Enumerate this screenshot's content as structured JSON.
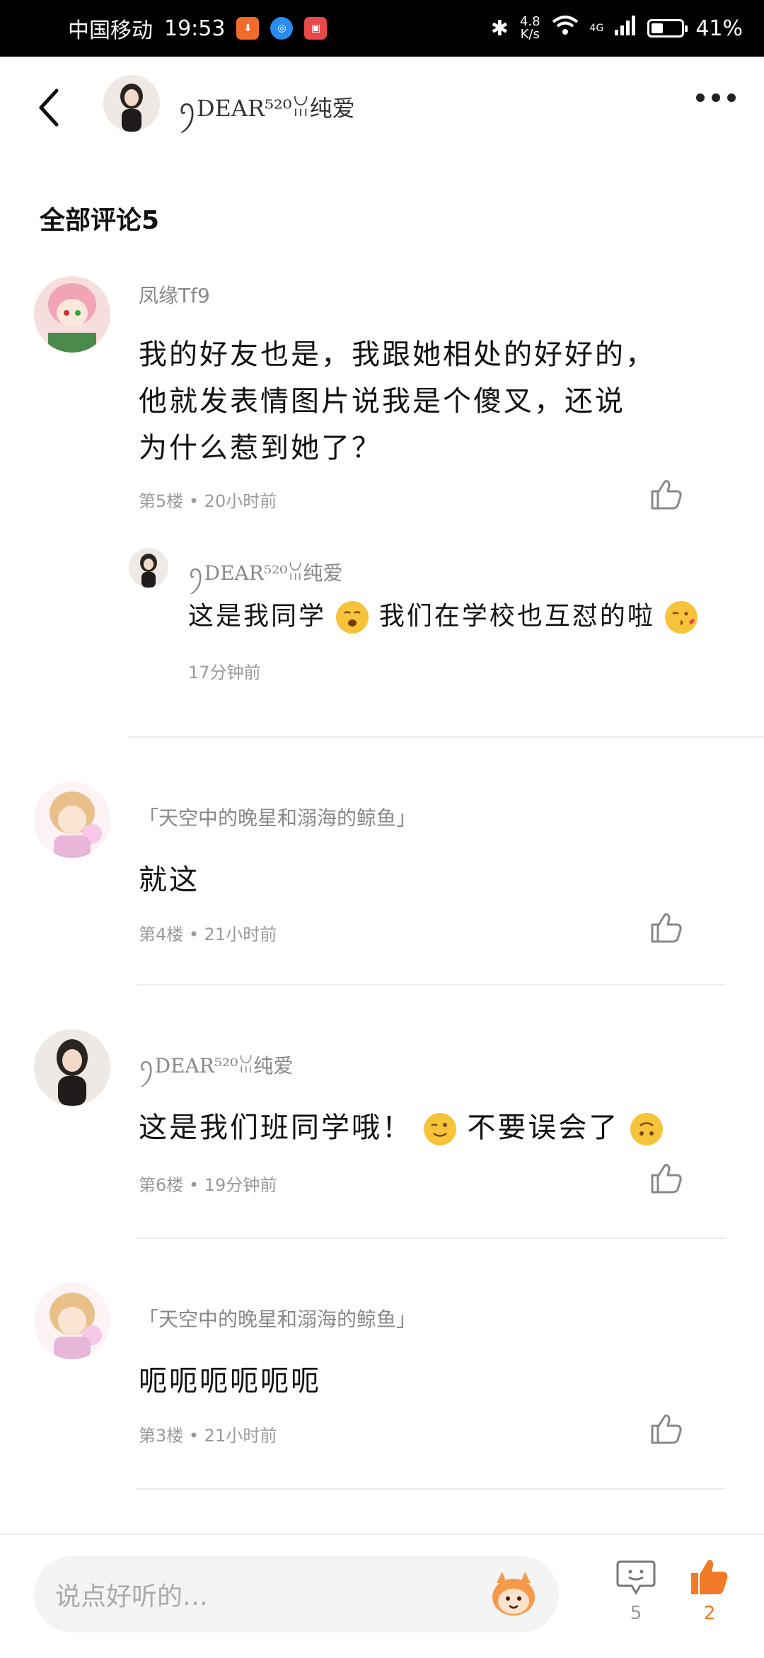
{
  "status_bar": {
    "carrier": "中国移动",
    "time": "19:53",
    "net_speed_value": "4.8",
    "net_speed_unit": "K/s",
    "signal": "4G",
    "battery": "41%",
    "battery_level": 0.41,
    "app_icons": [
      "download-app",
      "browser-app",
      "huawei-app"
    ]
  },
  "header": {
    "author_name": "ꪆDEAR⁵²⁰ꈍ纯爱"
  },
  "comments_section": {
    "title": "全部评论5"
  },
  "comments": [
    {
      "user": "凤缘Tf9",
      "text_lines": [
        "我的好友也是，我跟她相处的好好的，",
        "他就发表情图片说我是个傻叉，还说",
        "为什么惹到她了？"
      ],
      "meta": "第5楼 • 20小时前",
      "reply": {
        "user": "ꪆDEAR⁵²⁰ꈍ纯爱",
        "text_a": "这是我同学",
        "text_b": "我们在学校也互怼的啦",
        "meta": "17分钟前"
      }
    },
    {
      "user": "「天空中的晚星和溺海的鲸鱼」",
      "text": "就这",
      "meta": "第4楼 • 21小时前"
    },
    {
      "user": "ꪆDEAR⁵²⁰ꈍ纯爱",
      "text_a": "这是我们班同学哦！",
      "text_b": "不要误会了",
      "meta": "第6楼 • 19分钟前"
    },
    {
      "user": "「天空中的晚星和溺海的鲸鱼」",
      "text": "呃呃呃呃呃呃",
      "meta": "第3楼 • 21小时前"
    }
  ],
  "bottom_bar": {
    "input_placeholder": "说点好听的…",
    "comment_count": "5",
    "like_count": "2"
  },
  "colors": {
    "accent": "#f07a26",
    "meta_text": "#9a9a9a",
    "status_bar": "#000000"
  }
}
